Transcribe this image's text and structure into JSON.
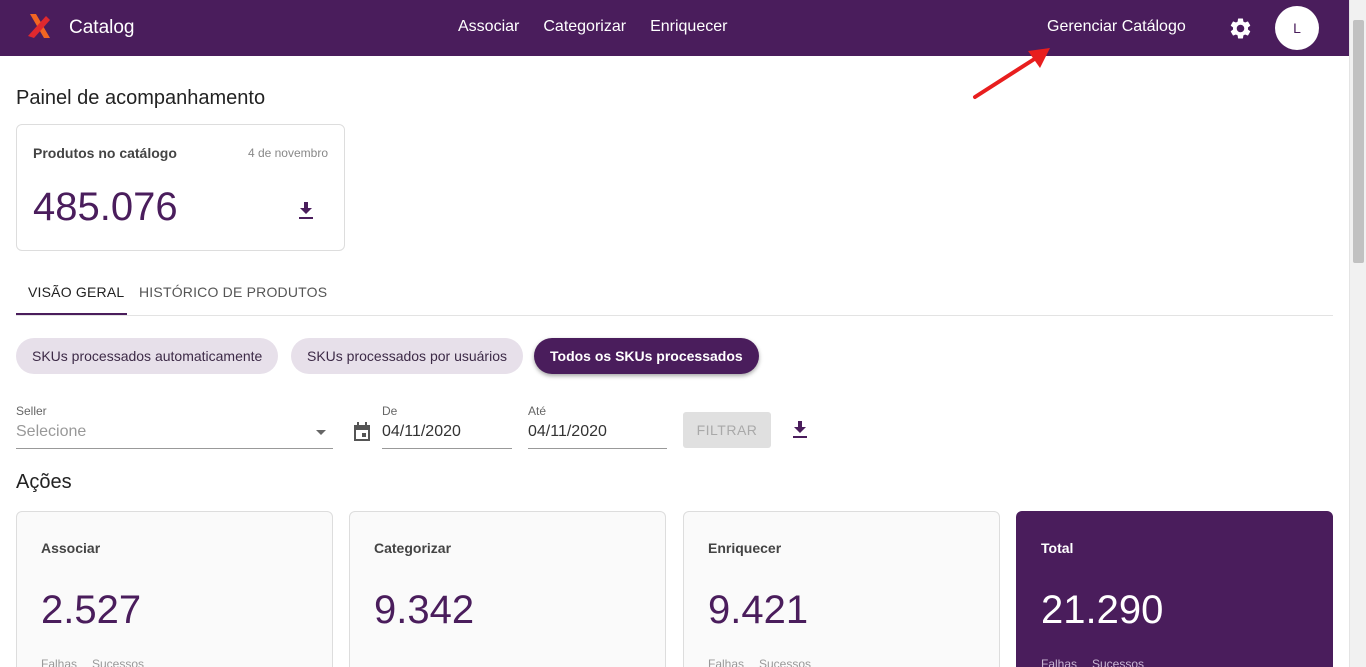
{
  "header": {
    "brand": "Catalog",
    "nav": [
      "Associar",
      "Categorizar",
      "Enriquecer"
    ],
    "manage_label": "Gerenciar Catálogo",
    "avatar_initial": "L",
    "colors": {
      "primary": "#4a1d5c",
      "logo_orange": "#f26522",
      "logo_red": "#e0282e",
      "annotation_arrow": "#e81e1e"
    }
  },
  "page": {
    "title": "Painel de acompanhamento",
    "catalog_card": {
      "label": "Produtos no catálogo",
      "date": "4 de novembro",
      "value": "485.076",
      "icon": "download-icon"
    },
    "tabs": [
      "VISÃO GERAL",
      "HISTÓRICO DE PRODUTOS"
    ],
    "chips": [
      "SKUs processados automaticamente",
      "SKUs processados por usuários",
      "Todos os SKUs processados"
    ],
    "filters": {
      "seller_label": "Seller",
      "seller_placeholder": "Selecione",
      "from_label": "De",
      "from_value": "04/11/2020",
      "to_label": "Até",
      "to_value": "04/11/2020",
      "filter_button": "FILTRAR"
    },
    "actions_title": "Ações",
    "action_cards": [
      {
        "label": "Associar",
        "value": "2.527",
        "sub1": "Falhas",
        "sub2": "Sucessos"
      },
      {
        "label": "Categorizar",
        "value": "9.342",
        "sub1": "",
        "sub2": ""
      },
      {
        "label": "Enriquecer",
        "value": "9.421",
        "sub1": "Falhas",
        "sub2": "Sucessos"
      },
      {
        "label": "Total",
        "value": "21.290",
        "sub1": "Falhas",
        "sub2": "Sucessos"
      }
    ]
  }
}
